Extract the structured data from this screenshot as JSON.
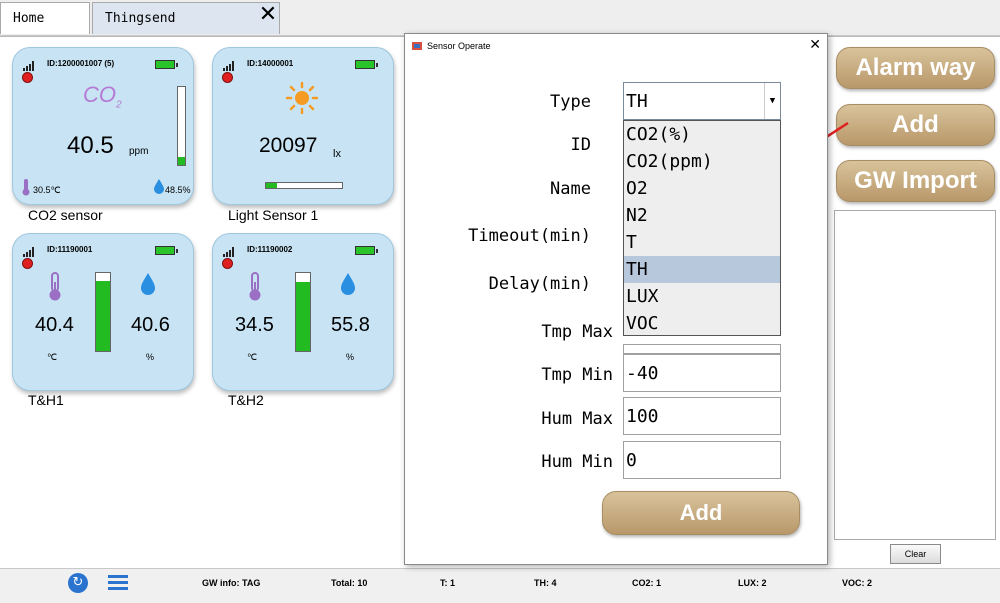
{
  "tabs": {
    "home": "Home",
    "thingsend": "Thingsend"
  },
  "cards": [
    {
      "id": "ID:1200001007  (5)",
      "name": "CO2 sensor",
      "label": "CO",
      "label_sub": "2",
      "value": "40.5",
      "unit": "ppm",
      "temp": "30.5℃",
      "hum": "48.5%",
      "level": 0.1
    },
    {
      "id": "ID:14000001",
      "name": "Light Sensor 1",
      "value": "20097",
      "unit": "lx",
      "level": 0.15
    },
    {
      "id": "ID:11190001",
      "name": "T&H1",
      "temp": "40.4",
      "temp_unit": "℃",
      "hum": "40.6",
      "hum_unit": "%",
      "level": 0.9
    },
    {
      "id": "ID:11190002",
      "name": "T&H2",
      "temp": "34.5",
      "temp_unit": "℃",
      "hum": "55.8",
      "hum_unit": "%",
      "level": 0.88
    }
  ],
  "side": {
    "alarm_way": "Alarm way",
    "add": "Add",
    "gw_import": "GW Import",
    "clear": "Clear"
  },
  "status": {
    "gw_info": "GW info: TAG",
    "total": "Total: 10",
    "t": "T: 1",
    "th": "TH: 4",
    "co2": "CO2: 1",
    "lux": "LUX: 2",
    "voc": "VOC: 2"
  },
  "dialog": {
    "title": "Sensor Operate",
    "close": "✕",
    "labels": {
      "type": "Type",
      "id": "ID",
      "name": "Name",
      "timeout": "Timeout(min)",
      "delay": "Delay(min)",
      "tmp_max": "Tmp Max",
      "tmp_min": "Tmp Min",
      "hum_max": "Hum Max",
      "hum_min": "Hum Min"
    },
    "type_value": "TH",
    "type_options": [
      "CO2(%)",
      "CO2(ppm)",
      "O2",
      "N2",
      "T",
      "TH",
      "LUX",
      "VOC"
    ],
    "selected_option": "TH",
    "values": {
      "tmp_min": "-40",
      "hum_max": "100",
      "hum_min": "0"
    },
    "add": "Add"
  },
  "colors": {
    "button_tan": "#c9ad80",
    "card_bg": "#c8e4f4",
    "accent_red": "#e02020",
    "bar_green": "#22bb22"
  }
}
